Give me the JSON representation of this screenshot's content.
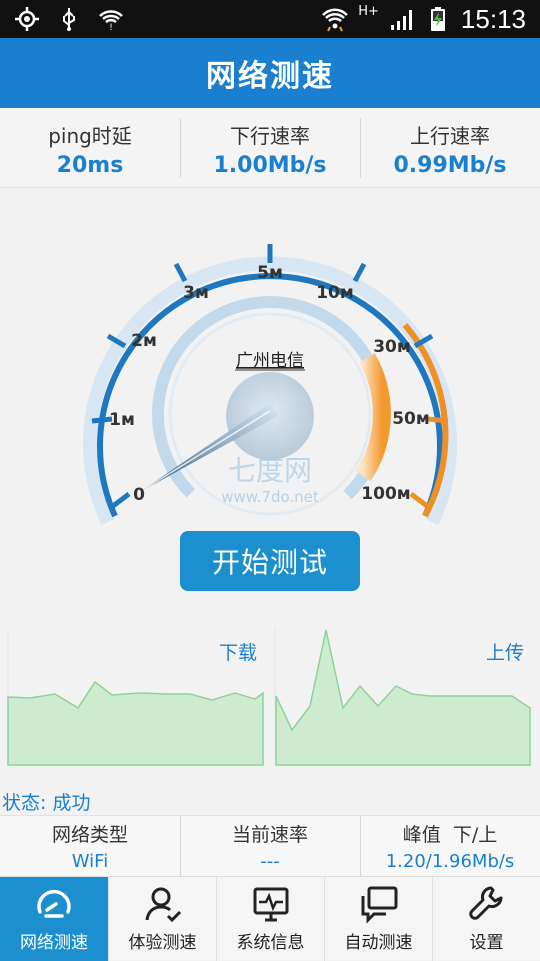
{
  "status_bar": {
    "time": "15:13",
    "network_type": "H+",
    "icons": [
      "location-icon",
      "usb-icon",
      "wifi-alert-icon",
      "wifi-icon",
      "signal-icon",
      "battery-charging-icon"
    ]
  },
  "title": "网络测速",
  "stats": {
    "ping": {
      "label": "ping时延",
      "value": "20ms"
    },
    "download": {
      "label": "下行速率",
      "value": "1.00Mb/s"
    },
    "upload": {
      "label": "上行速率",
      "value": "0.99Mb/s"
    }
  },
  "gauge": {
    "isp": "广州电信",
    "tick_labels": [
      "0",
      "1м",
      "2м",
      "3м",
      "5м",
      "10м",
      "30м",
      "50м",
      "100м"
    ],
    "watermark_cn": "七度网",
    "watermark_url": "www.7do.net",
    "needle_value": "0"
  },
  "start_button": "开始测试",
  "graphs": {
    "download_label": "下载",
    "upload_label": "上传"
  },
  "status_text": "状态: 成功",
  "info": {
    "network_type": {
      "label": "网络类型",
      "value": "WiFi"
    },
    "current_speed": {
      "label": "当前速率",
      "value": "---"
    },
    "peak": {
      "label": "峰值  下/上",
      "value": "1.20/1.96Mb/s"
    }
  },
  "tabs": [
    {
      "label": "网络测速",
      "icon": "speedometer-icon",
      "active": true
    },
    {
      "label": "体验测速",
      "icon": "user-check-icon",
      "active": false
    },
    {
      "label": "系统信息",
      "icon": "monitor-pulse-icon",
      "active": false
    },
    {
      "label": "自动测速",
      "icon": "chat-bubbles-icon",
      "active": false
    },
    {
      "label": "设置",
      "icon": "wrench-icon",
      "active": false
    }
  ],
  "colors": {
    "primary": "#1b7fd0",
    "accent_orange": "#f39a2e",
    "graph_fill": "#cdeccf",
    "graph_line": "#8fd19a"
  }
}
